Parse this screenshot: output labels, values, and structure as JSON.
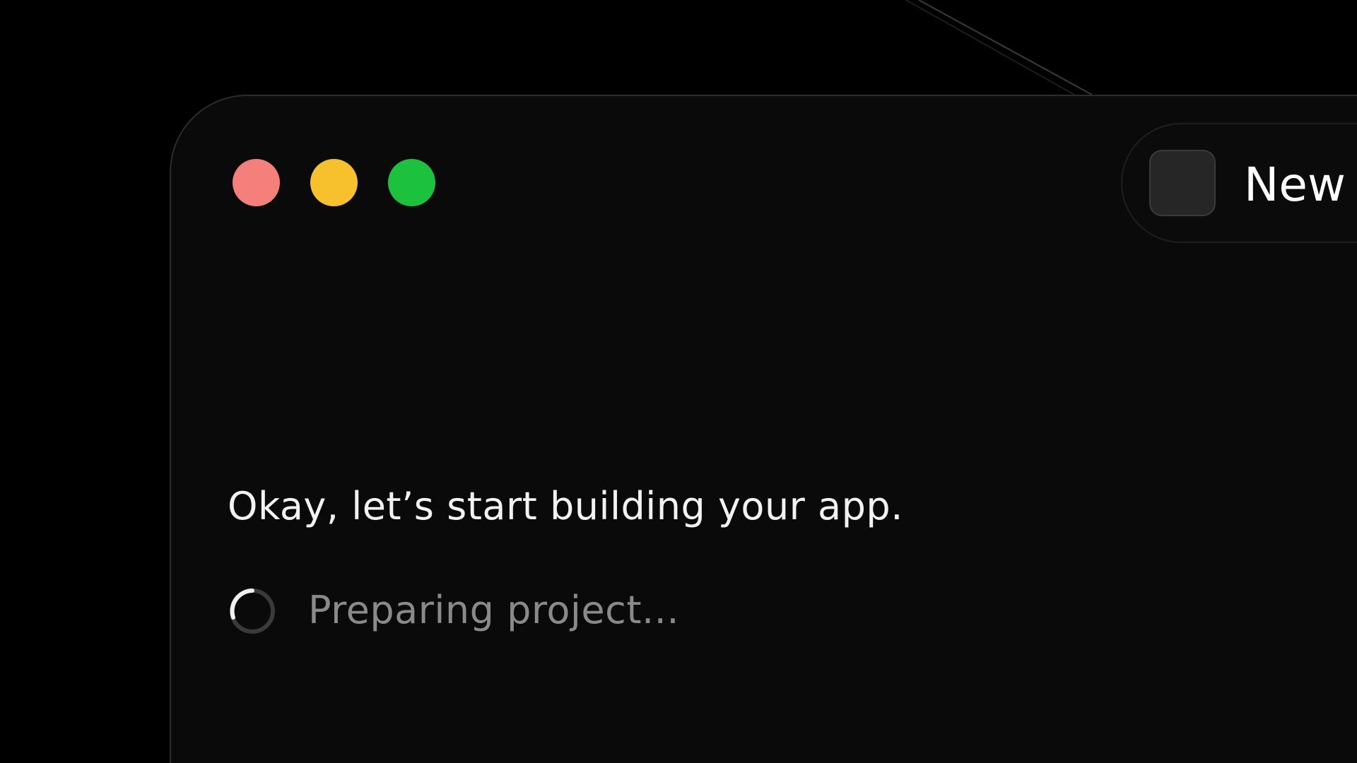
{
  "window": {
    "traffic_lights": [
      {
        "name": "close",
        "color": "#f47f7b"
      },
      {
        "name": "minimize",
        "color": "#f7c12d"
      },
      {
        "name": "zoom",
        "color": "#1cc23d"
      }
    ],
    "new_button": {
      "label": "New",
      "icon": "app-tile-icon"
    }
  },
  "content": {
    "message": "Okay, let’s start building your app.",
    "status": "Preparing project...",
    "status_icon": "loading-spinner-icon"
  },
  "colors": {
    "background": "#000000",
    "window": "#0a0a0a",
    "text_primary": "#f2f2f2",
    "text_secondary": "#8a8a8a"
  }
}
